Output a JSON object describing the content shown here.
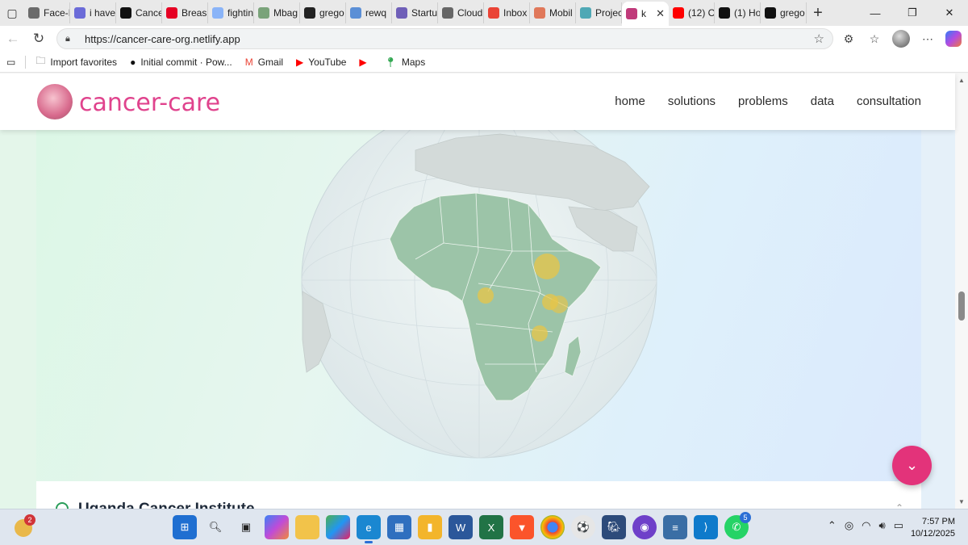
{
  "browser": {
    "tabs": [
      {
        "label": "Face-I",
        "fav_color": "#6b6b6b"
      },
      {
        "label": "i have",
        "fav_color": "#6b6bd8"
      },
      {
        "label": "Cance",
        "fav_color": "#111111"
      },
      {
        "label": "Breas",
        "fav_color": "#e60023"
      },
      {
        "label": "fightin",
        "fav_color": "#8ab4f8"
      },
      {
        "label": "Mbag",
        "fav_color": "#7aa37a"
      },
      {
        "label": "grego",
        "fav_color": "#222222"
      },
      {
        "label": "rewq",
        "fav_color": "#5b8fd6"
      },
      {
        "label": "Startu",
        "fav_color": "#6f5fb8"
      },
      {
        "label": "Cloud",
        "fav_color": "#666666"
      },
      {
        "label": "Inbox",
        "fav_color": "#ea4335"
      },
      {
        "label": "Mobil",
        "fav_color": "#e0785a"
      },
      {
        "label": "Projec",
        "fav_color": "#4fa8b5"
      },
      {
        "label": "k",
        "fav_color": "#c03a7a",
        "active": true
      },
      {
        "label": "(12) C",
        "fav_color": "#ff0000"
      },
      {
        "label": "(1) Ho",
        "fav_color": "#111111"
      },
      {
        "label": "grego",
        "fav_color": "#111111"
      }
    ],
    "url": "https://cancer-care-org.netlify.app",
    "bookmarks": [
      {
        "label": "Import favorites",
        "icon": "folder-icon"
      },
      {
        "label": "Initial commit · Pow...",
        "icon": "github-icon"
      },
      {
        "label": "Gmail",
        "icon": "gmail-icon"
      },
      {
        "label": "YouTube",
        "icon": "youtube-icon"
      },
      {
        "label": "",
        "icon": "youtube-icon"
      },
      {
        "label": "Maps",
        "icon": "maps-icon"
      }
    ]
  },
  "site": {
    "logo_text": "cancer-care",
    "nav": [
      "home",
      "solutions",
      "problems",
      "data",
      "consultation"
    ],
    "institute_title": "Uganda Cancer Institute",
    "fab_icon": "chevron-down-icon"
  },
  "globe": {
    "markers": [
      "ethiopia-marker",
      "drc-marker",
      "kenya-marker",
      "kenya-coast-marker",
      "tanzania-marker"
    ]
  },
  "taskbar": {
    "weather_badge": "2",
    "whatsapp_badge": "5",
    "time": "7:57 PM",
    "date": "10/12/2025"
  },
  "colors": {
    "brand_pink": "#e0438d",
    "fab_pink": "#e3337a",
    "land_green": "#9cc4a8",
    "marker_yellow": "#e8c547"
  }
}
